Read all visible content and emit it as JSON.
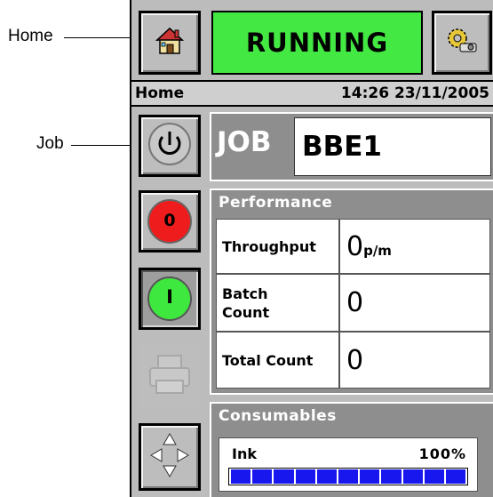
{
  "callouts": {
    "home": "Home",
    "job": "Job"
  },
  "header": {
    "status": "RUNNING",
    "status_color": "#43e843",
    "home_icon": "house-icon",
    "settings_icon": "gears-settings-icon"
  },
  "infobar": {
    "page": "Home",
    "datetime": "14:26 23/11/2005"
  },
  "sidebar": {
    "power_icon": "power-icon",
    "stop_label": "0",
    "start_label": "I",
    "printer_icon": "printer-icon",
    "navigate_icon": "navigate-arrows-icon"
  },
  "job": {
    "label": "JOB",
    "name": "BBE1"
  },
  "performance": {
    "title": "Performance",
    "throughput_label": "Throughput",
    "throughput_value": "0",
    "throughput_unit": "p/m",
    "batch_label_line1": "Batch",
    "batch_label_line2": "Count",
    "batch_value": "0",
    "total_label": "Total Count",
    "total_value": "0"
  },
  "consumables": {
    "title": "Consumables",
    "ink_label": "Ink",
    "ink_percent_text": "100%",
    "ink_level": 1.0,
    "ink_color": "#1818ee"
  }
}
